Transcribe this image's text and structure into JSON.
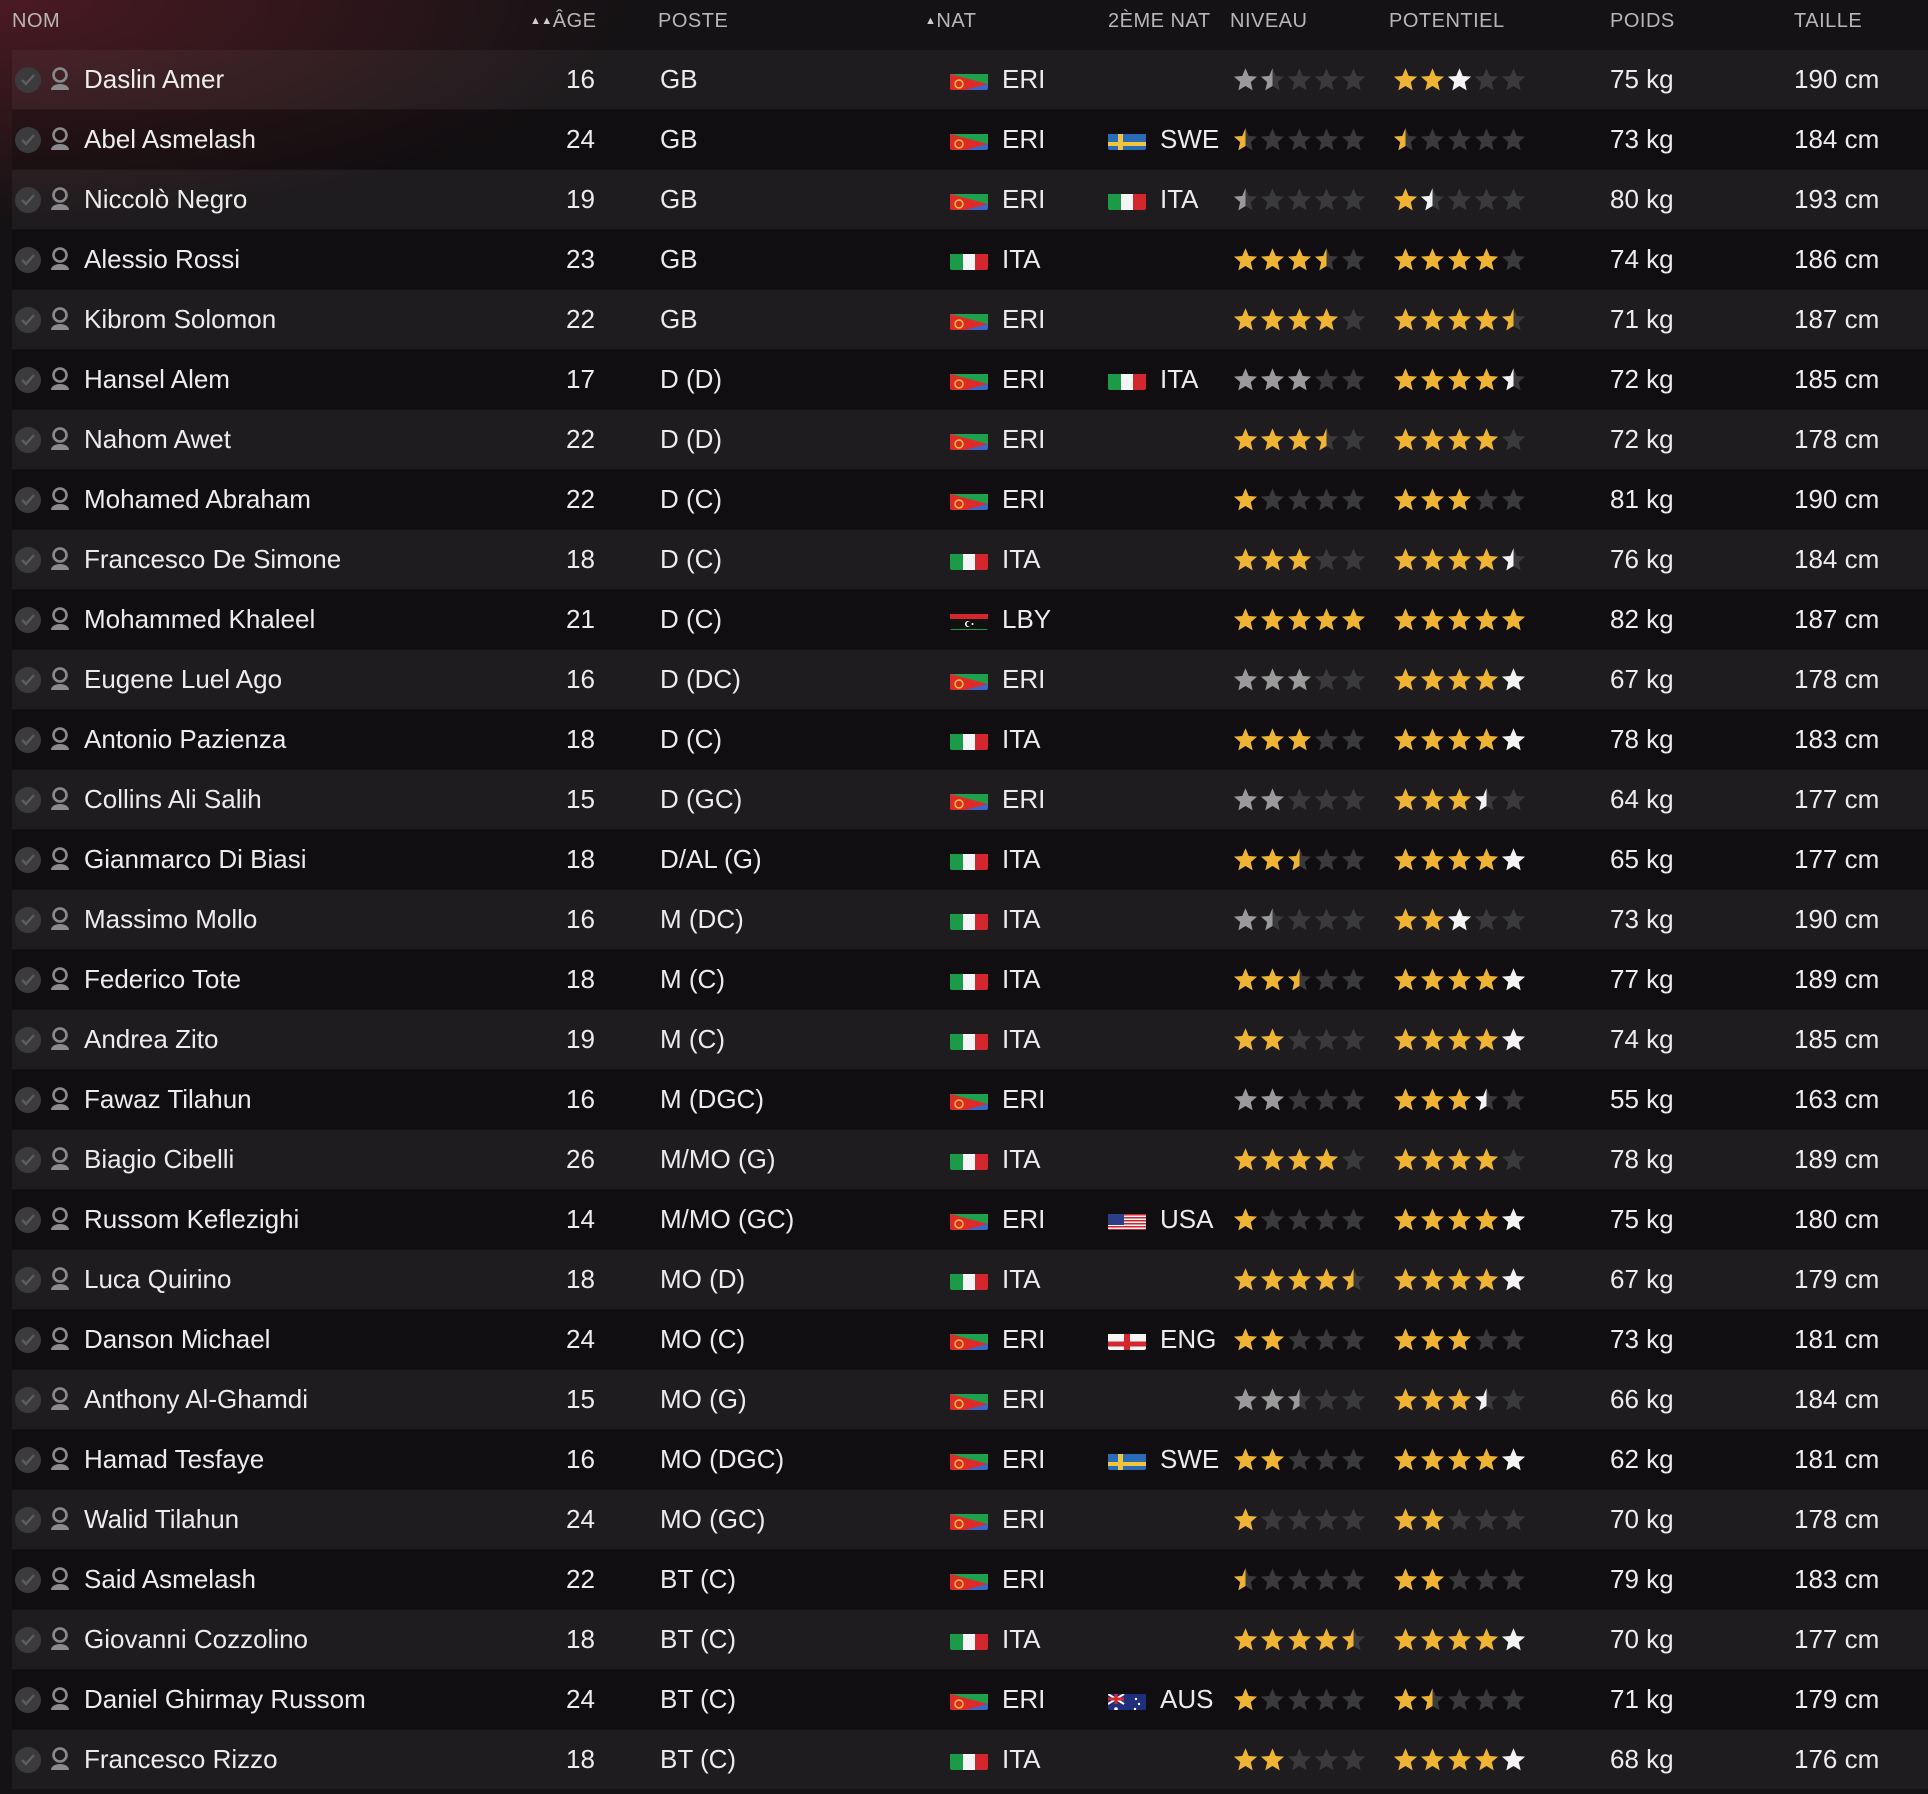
{
  "headers": {
    "nom": "NOM",
    "age": "ÂGE",
    "poste": "POSTE",
    "nat": "NAT",
    "nat2": "2ÈME NAT",
    "niveau": "NIVEAU",
    "potentiel": "POTENTIEL",
    "poids": "POIDS",
    "taille": "TAILLE"
  },
  "sort": {
    "age_arrows": "▲▲",
    "nat_arrow": "▲"
  },
  "colors": {
    "star_gold": "#f0b434",
    "star_white": "#f4f4f4",
    "star_grey": "#9a9a9a",
    "star_empty": "#3a393b"
  },
  "players": [
    {
      "name": "Daslin Amer",
      "age": "16",
      "pos": "GB",
      "nat": "ERI",
      "nat2": "",
      "lvl": 1.5,
      "lvl_color": "grey",
      "pot": 3,
      "pot_color": "gold",
      "pot_last_white": true,
      "weight": "75 kg",
      "height": "190 cm"
    },
    {
      "name": "Abel Asmelash",
      "age": "24",
      "pos": "GB",
      "nat": "ERI",
      "nat2": "SWE",
      "lvl": 0.5,
      "lvl_color": "gold",
      "pot": 0.5,
      "pot_color": "gold",
      "pot_last_white": false,
      "weight": "73 kg",
      "height": "184 cm"
    },
    {
      "name": "Niccolò Negro",
      "age": "19",
      "pos": "GB",
      "nat": "ERI",
      "nat2": "ITA",
      "lvl": 0.5,
      "lvl_color": "grey",
      "pot": 1.5,
      "pot_color": "gold",
      "pot_last_white": true,
      "weight": "80 kg",
      "height": "193 cm"
    },
    {
      "name": "Alessio Rossi",
      "age": "23",
      "pos": "GB",
      "nat": "ITA",
      "nat2": "",
      "lvl": 3.5,
      "lvl_color": "gold",
      "pot": 4,
      "pot_color": "gold",
      "pot_last_white": false,
      "weight": "74 kg",
      "height": "186 cm"
    },
    {
      "name": "Kibrom Solomon",
      "age": "22",
      "pos": "GB",
      "nat": "ERI",
      "nat2": "",
      "lvl": 4,
      "lvl_color": "gold",
      "pot": 4.5,
      "pot_color": "gold",
      "pot_last_white": false,
      "weight": "71 kg",
      "height": "187 cm"
    },
    {
      "name": "Hansel Alem",
      "age": "17",
      "pos": "D (D)",
      "nat": "ERI",
      "nat2": "ITA",
      "lvl": 3,
      "lvl_color": "grey",
      "pot": 4.5,
      "pot_color": "gold",
      "pot_last_white": true,
      "weight": "72 kg",
      "height": "185 cm"
    },
    {
      "name": "Nahom Awet",
      "age": "22",
      "pos": "D (D)",
      "nat": "ERI",
      "nat2": "",
      "lvl": 3.5,
      "lvl_color": "gold",
      "pot": 4,
      "pot_color": "gold",
      "pot_last_white": false,
      "weight": "72 kg",
      "height": "178 cm"
    },
    {
      "name": "Mohamed Abraham",
      "age": "22",
      "pos": "D (C)",
      "nat": "ERI",
      "nat2": "",
      "lvl": 1,
      "lvl_color": "gold",
      "pot": 3,
      "pot_color": "gold",
      "pot_last_white": false,
      "weight": "81 kg",
      "height": "190 cm"
    },
    {
      "name": "Francesco De Simone",
      "age": "18",
      "pos": "D (C)",
      "nat": "ITA",
      "nat2": "",
      "lvl": 3,
      "lvl_color": "gold",
      "pot": 4.5,
      "pot_color": "gold",
      "pot_last_white": true,
      "weight": "76 kg",
      "height": "184 cm"
    },
    {
      "name": "Mohammed Khaleel",
      "age": "21",
      "pos": "D (C)",
      "nat": "LBY",
      "nat2": "",
      "lvl": 5,
      "lvl_color": "gold",
      "pot": 5,
      "pot_color": "gold",
      "pot_last_white": false,
      "weight": "82 kg",
      "height": "187 cm"
    },
    {
      "name": "Eugene Luel Ago",
      "age": "16",
      "pos": "D (DC)",
      "nat": "ERI",
      "nat2": "",
      "lvl": 3,
      "lvl_color": "grey",
      "pot": 5,
      "pot_color": "gold",
      "pot_last_white": true,
      "weight": "67 kg",
      "height": "178 cm"
    },
    {
      "name": "Antonio Pazienza",
      "age": "18",
      "pos": "D (C)",
      "nat": "ITA",
      "nat2": "",
      "lvl": 3,
      "lvl_color": "gold",
      "pot": 5,
      "pot_color": "gold",
      "pot_last_white": true,
      "weight": "78 kg",
      "height": "183 cm"
    },
    {
      "name": "Collins Ali Salih",
      "age": "15",
      "pos": "D (GC)",
      "nat": "ERI",
      "nat2": "",
      "lvl": 2,
      "lvl_color": "grey",
      "pot": 3.5,
      "pot_color": "gold",
      "pot_last_white": true,
      "weight": "64 kg",
      "height": "177 cm"
    },
    {
      "name": "Gianmarco Di Biasi",
      "age": "18",
      "pos": "D/AL (G)",
      "nat": "ITA",
      "nat2": "",
      "lvl": 2.5,
      "lvl_color": "gold",
      "pot": 5,
      "pot_color": "gold",
      "pot_last_white": true,
      "weight": "65 kg",
      "height": "177 cm"
    },
    {
      "name": "Massimo Mollo",
      "age": "16",
      "pos": "M (DC)",
      "nat": "ITA",
      "nat2": "",
      "lvl": 1.5,
      "lvl_color": "grey",
      "pot": 3,
      "pot_color": "gold",
      "pot_last_white": true,
      "weight": "73 kg",
      "height": "190 cm"
    },
    {
      "name": "Federico Tote",
      "age": "18",
      "pos": "M (C)",
      "nat": "ITA",
      "nat2": "",
      "lvl": 2.5,
      "lvl_color": "gold",
      "pot": 5,
      "pot_color": "gold",
      "pot_last_white": true,
      "weight": "77 kg",
      "height": "189 cm"
    },
    {
      "name": "Andrea Zito",
      "age": "19",
      "pos": "M (C)",
      "nat": "ITA",
      "nat2": "",
      "lvl": 2,
      "lvl_color": "gold",
      "pot": 5,
      "pot_color": "gold",
      "pot_last_white": true,
      "weight": "74 kg",
      "height": "185 cm"
    },
    {
      "name": "Fawaz Tilahun",
      "age": "16",
      "pos": "M (DGC)",
      "nat": "ERI",
      "nat2": "",
      "lvl": 2,
      "lvl_color": "grey",
      "pot": 3.5,
      "pot_color": "gold",
      "pot_last_white": true,
      "weight": "55 kg",
      "height": "163 cm"
    },
    {
      "name": "Biagio Cibelli",
      "age": "26",
      "pos": "M/MO (G)",
      "nat": "ITA",
      "nat2": "",
      "lvl": 4,
      "lvl_color": "gold",
      "pot": 4,
      "pot_color": "gold",
      "pot_last_white": false,
      "weight": "78 kg",
      "height": "189 cm"
    },
    {
      "name": "Russom Keflezighi",
      "age": "14",
      "pos": "M/MO (GC)",
      "nat": "ERI",
      "nat2": "USA",
      "lvl": 1,
      "lvl_color": "gold",
      "pot": 5,
      "pot_color": "gold",
      "pot_last_white": true,
      "weight": "75 kg",
      "height": "180 cm"
    },
    {
      "name": "Luca Quirino",
      "age": "18",
      "pos": "MO (D)",
      "nat": "ITA",
      "nat2": "",
      "lvl": 4.5,
      "lvl_color": "gold",
      "pot": 5,
      "pot_color": "gold",
      "pot_last_white": true,
      "weight": "67 kg",
      "height": "179 cm"
    },
    {
      "name": "Danson Michael",
      "age": "24",
      "pos": "MO (C)",
      "nat": "ERI",
      "nat2": "ENG",
      "lvl": 2,
      "lvl_color": "gold",
      "pot": 3,
      "pot_color": "gold",
      "pot_last_white": false,
      "weight": "73 kg",
      "height": "181 cm"
    },
    {
      "name": "Anthony Al-Ghamdi",
      "age": "15",
      "pos": "MO (G)",
      "nat": "ERI",
      "nat2": "",
      "lvl": 2.5,
      "lvl_color": "grey",
      "pot": 3.5,
      "pot_color": "gold",
      "pot_last_white": true,
      "weight": "66 kg",
      "height": "184 cm"
    },
    {
      "name": "Hamad Tesfaye",
      "age": "16",
      "pos": "MO (DGC)",
      "nat": "ERI",
      "nat2": "SWE",
      "lvl": 2,
      "lvl_color": "gold",
      "pot": 5,
      "pot_color": "gold",
      "pot_last_white": true,
      "weight": "62 kg",
      "height": "181 cm"
    },
    {
      "name": "Walid Tilahun",
      "age": "24",
      "pos": "MO (GC)",
      "nat": "ERI",
      "nat2": "",
      "lvl": 1,
      "lvl_color": "gold",
      "pot": 2,
      "pot_color": "gold",
      "pot_last_white": false,
      "weight": "70 kg",
      "height": "178 cm"
    },
    {
      "name": "Said Asmelash",
      "age": "22",
      "pos": "BT (C)",
      "nat": "ERI",
      "nat2": "",
      "lvl": 0.5,
      "lvl_color": "gold",
      "pot": 2,
      "pot_color": "gold",
      "pot_last_white": false,
      "weight": "79 kg",
      "height": "183 cm"
    },
    {
      "name": "Giovanni Cozzolino",
      "age": "18",
      "pos": "BT (C)",
      "nat": "ITA",
      "nat2": "",
      "lvl": 4.5,
      "lvl_color": "gold",
      "pot": 5,
      "pot_color": "gold",
      "pot_last_white": true,
      "weight": "70 kg",
      "height": "177 cm"
    },
    {
      "name": "Daniel Ghirmay Russom",
      "age": "24",
      "pos": "BT (C)",
      "nat": "ERI",
      "nat2": "AUS",
      "lvl": 1,
      "lvl_color": "gold",
      "pot": 1.5,
      "pot_color": "gold",
      "pot_last_white": false,
      "weight": "71 kg",
      "height": "179 cm"
    },
    {
      "name": "Francesco Rizzo",
      "age": "18",
      "pos": "BT (C)",
      "nat": "ITA",
      "nat2": "",
      "lvl": 2,
      "lvl_color": "gold",
      "pot": 5,
      "pot_color": "gold",
      "pot_last_white": true,
      "weight": "68 kg",
      "height": "176 cm"
    }
  ]
}
